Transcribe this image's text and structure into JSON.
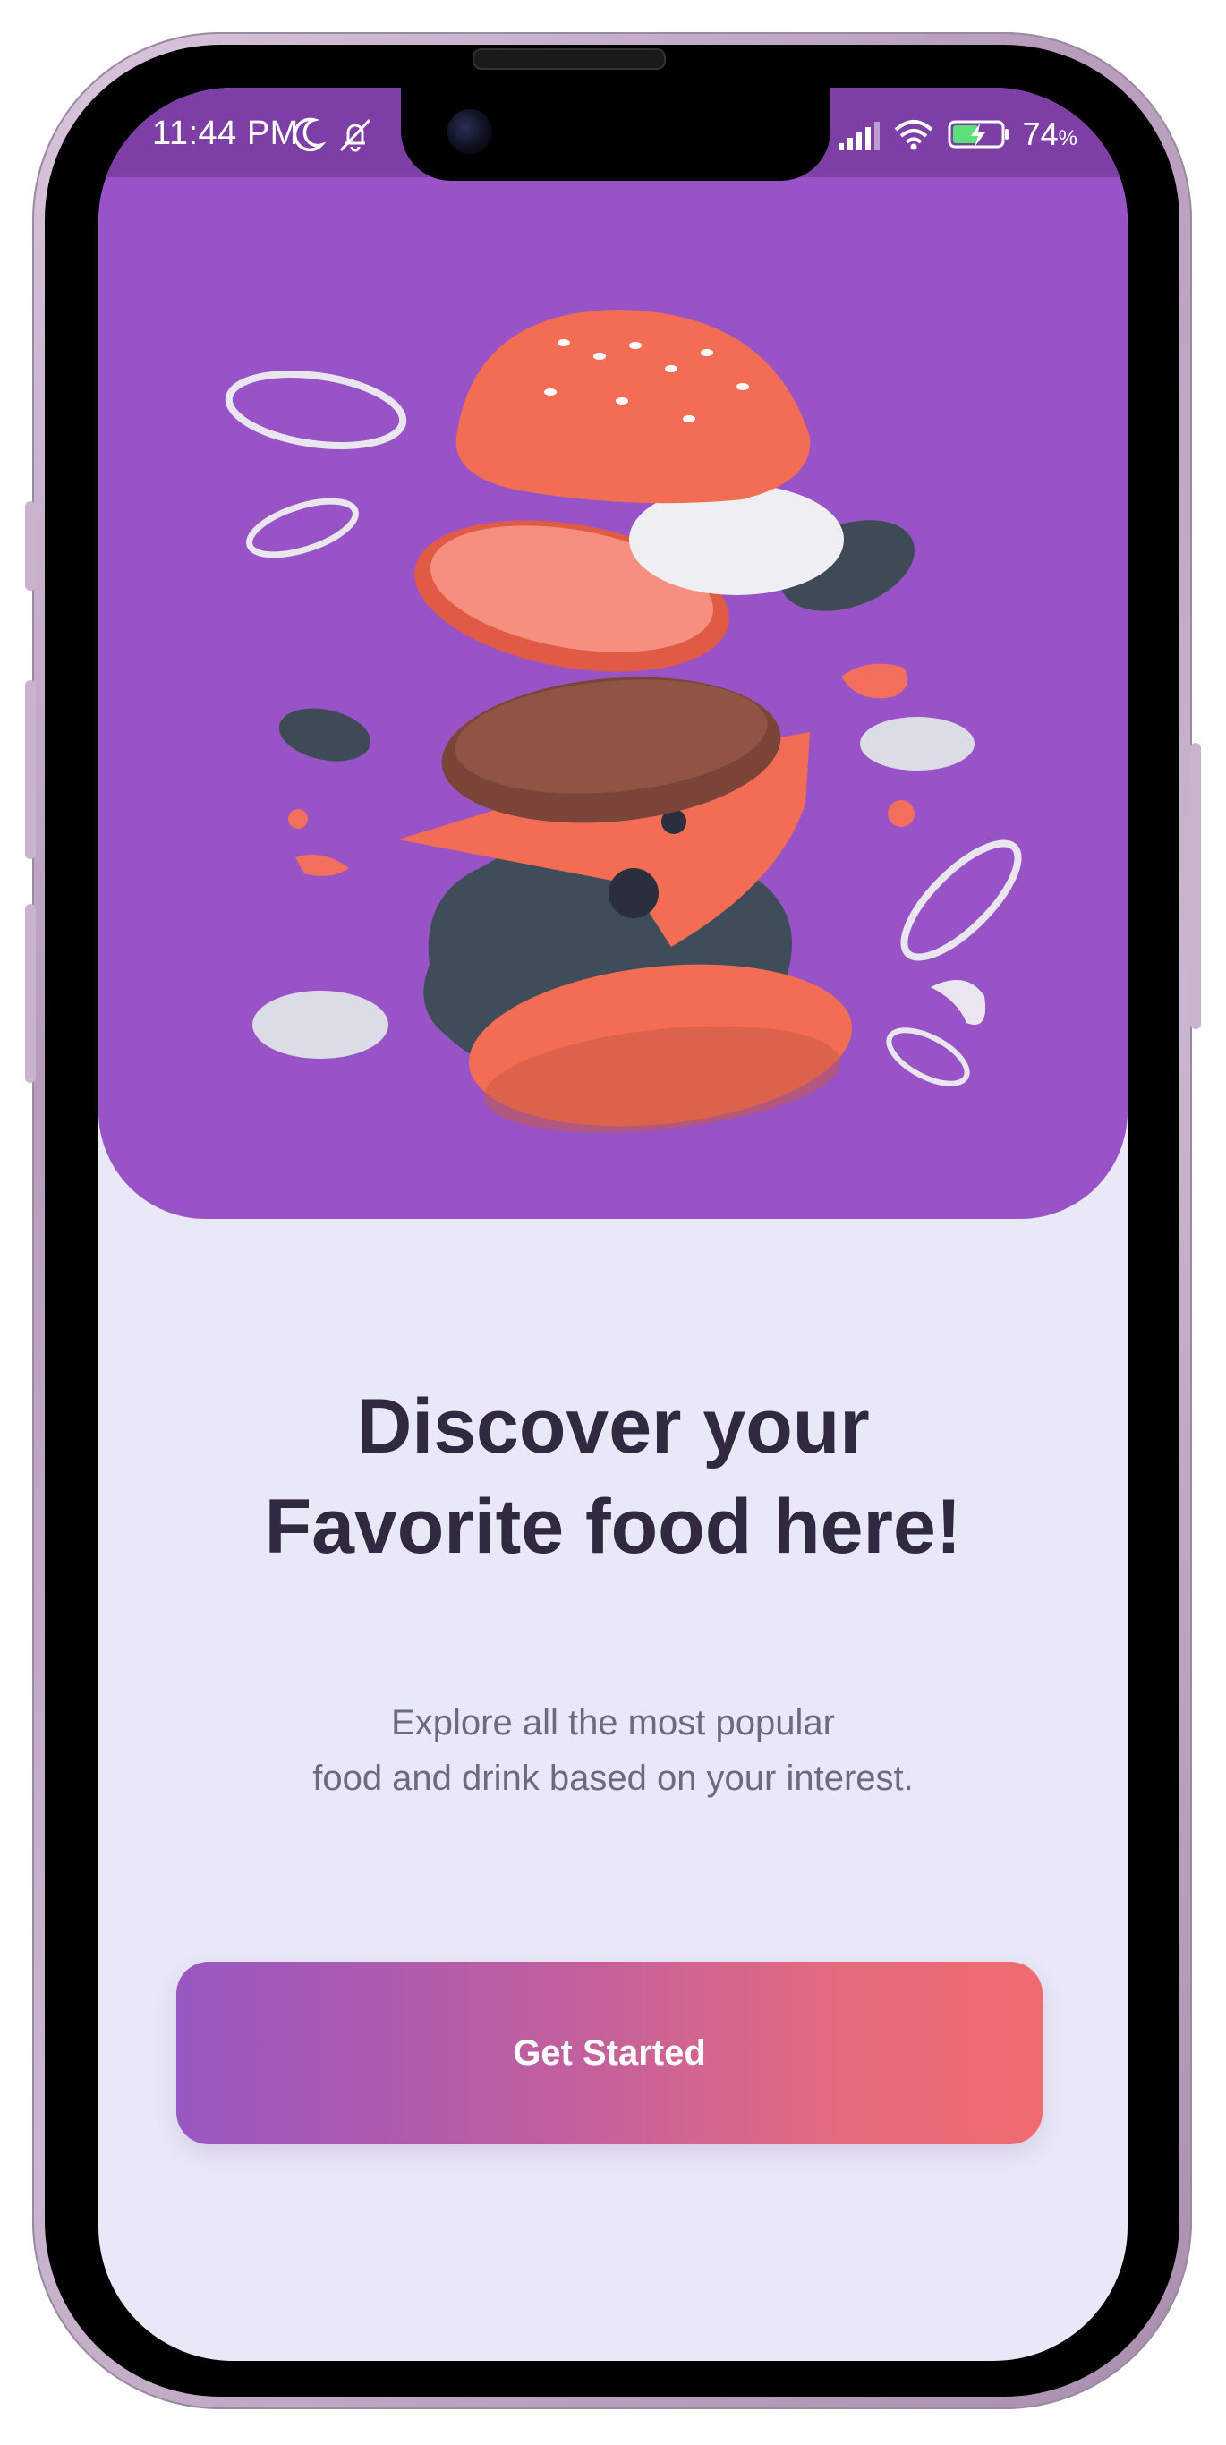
{
  "status_bar": {
    "time": "11:44 PM",
    "battery_percent": "74",
    "battery_unit": "%",
    "icons": [
      "moon-icon",
      "bell-off-icon",
      "signal-icon",
      "wifi-icon",
      "battery-charging-icon"
    ]
  },
  "hero": {
    "illustration": "burger-illustration",
    "background_color": "#9854c6"
  },
  "onboarding": {
    "title_line1": "Discover your",
    "title_line2": "Favorite food here!",
    "subtitle_line1": "Explore all the most popular",
    "subtitle_line2": "food and drink based on your interest.",
    "cta_label": "Get Started"
  },
  "colors": {
    "accent_start": "#9857c2",
    "accent_end": "#f06b6f",
    "title": "#31293f",
    "page_background": "#e8e8f6"
  }
}
